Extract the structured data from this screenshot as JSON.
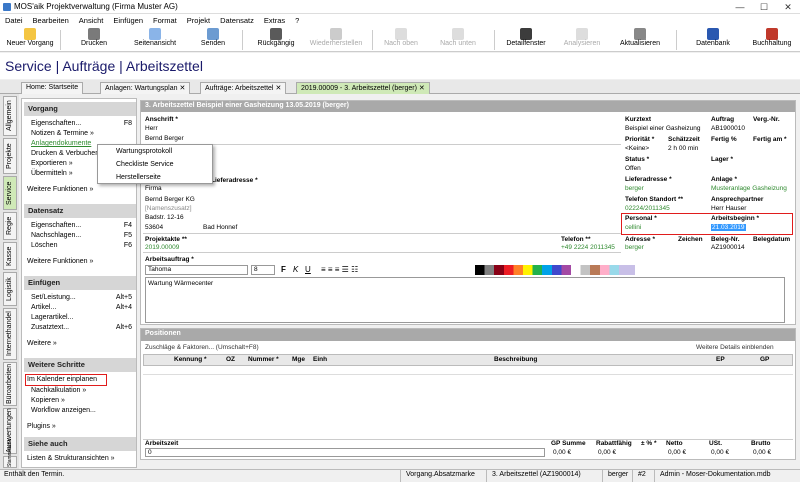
{
  "title": "MOS'aik Projektverwaltung (Firma Muster AG)",
  "menu": [
    "Datei",
    "Bearbeiten",
    "Ansicht",
    "Einfügen",
    "Format",
    "Projekt",
    "Datensatz",
    "Extras",
    "?"
  ],
  "toolbar": [
    "Neuer Vorgang",
    "Drucken",
    "Seitenansicht",
    "Senden",
    "Rückgängig",
    "Wiederherstellen",
    "Nach oben",
    "Nach unten",
    "Detailfenster",
    "Analysieren",
    "Aktualisieren",
    "Datenbank",
    "Buchhaltung"
  ],
  "page_title": "Service | Aufträge | Arbeitszettel",
  "tabs": [
    "Home: Startseite",
    "Anlagen: Wartungsplan",
    "Aufträge: Arbeitszettel",
    "2019.00009 - 3. Arbeitszettel (berger)"
  ],
  "vtabs": [
    "Allgemein",
    "Projekte",
    "Service",
    "Regie",
    "Kasse",
    "Logistik",
    "Internethandel",
    "Büroarbeiten",
    "Auswertungen",
    "Stammdaten"
  ],
  "sidebar": {
    "vorgang": {
      "title": "Vorgang",
      "items": [
        {
          "l": "Eigenschaften...",
          "k": "F8"
        },
        {
          "l": "Notizen & Termine »",
          "k": ""
        },
        {
          "l": "Anlagendokumente",
          "k": ""
        },
        {
          "l": "Drucken & Verbuchen",
          "k": ""
        },
        {
          "l": "Exportieren »",
          "k": ""
        },
        {
          "l": "Übermitteln »",
          "k": ""
        },
        {
          "l": "Weitere Funktionen »",
          "k": ""
        }
      ]
    },
    "datensatz": {
      "title": "Datensatz",
      "items": [
        {
          "l": "Eigenschaften...",
          "k": "F4"
        },
        {
          "l": "Nachschlagen...",
          "k": "F5"
        },
        {
          "l": "Löschen",
          "k": "F6"
        },
        {
          "l": "Weitere Funktionen »",
          "k": ""
        }
      ]
    },
    "einfuegen": {
      "title": "Einfügen",
      "items": [
        {
          "l": "Set/Leistung...",
          "k": "Alt+5"
        },
        {
          "l": "Artikel...",
          "k": "Alt+4"
        },
        {
          "l": "Lagerartikel...",
          "k": ""
        },
        {
          "l": "Zusatztext...",
          "k": "Alt+6"
        },
        {
          "l": "Weitere »",
          "k": ""
        }
      ]
    },
    "schritte": {
      "title": "Weitere Schritte",
      "items": [
        {
          "l": "Im Kalender einplanen",
          "k": ""
        },
        {
          "l": "Nachkalkulation »",
          "k": ""
        },
        {
          "l": "Kopieren »",
          "k": ""
        },
        {
          "l": "Workflow anzeigen...",
          "k": ""
        },
        {
          "l": "Plugins »",
          "k": ""
        }
      ]
    },
    "suche": {
      "title": "Siehe auch",
      "items": [
        {
          "l": "Listen & Strukturansichten »",
          "k": ""
        }
      ]
    }
  },
  "context_menu": [
    "Wartungsprotokoll",
    "Checkliste Service",
    "Herstellerseite"
  ],
  "main": {
    "header": "3. Arbeitszettel Beispiel einer Gasheizung 13.05.2019 (berger)",
    "anschrift_label": "Anschrift *",
    "anschrift": [
      "Herr",
      "Bernd Berger"
    ],
    "lieferanschrift_label": "Lieferadresse *",
    "rechnung_firma": "Firma",
    "rechnung": [
      "Bernd Berger KG",
      "[Namenszusatz]",
      "Badstr. 12-16"
    ],
    "plz": "53604",
    "ort": "Bad Honnef",
    "projektakte_label": "Projektakte **",
    "projektakte": "2019.00009",
    "telefon_label": "Telefon **",
    "telefon": "+49 2224 2011345",
    "kurztext_label": "Kurztext",
    "kurztext": "Beispiel einer Gasheizung",
    "auftrag_label": "Auftrag",
    "auftrag": "AB1900010",
    "verg_label": "Verg.-Nr.",
    "prioritaet_label": "Priorität *",
    "prioritaet": "<Keine>",
    "schaetzzeit_label": "Schätzzeit",
    "schaetzzeit": "2 h 00 min",
    "fertig_label": "Fertig %",
    "fertigam_label": "Fertig am *",
    "status_label": "Status *",
    "status": "Offen",
    "lager_label": "Lager *",
    "lieferadresse_label": "Lieferadresse *",
    "lieferadresse": "berger",
    "anlage_label": "Anlage *",
    "anlage": "Musteranlage Gasheizung",
    "telstandort_label": "Telefon Standort **",
    "telstandort": "02224/2011345",
    "ansprechpartner_label": "Ansprechpartner",
    "ansprechpartner": "Herr Hauser",
    "personal_label": "Personal *",
    "personal": "cellini",
    "arbeitsbeginn_label": "Arbeitsbeginn *",
    "arbeitsbeginn": "21.03.2019",
    "adresse_label": "Adresse *",
    "adresse": "berger",
    "zeichen_label": "Zeichen",
    "belegnr_label": "Beleg-Nr.",
    "belegnr": "AZ1900014",
    "belegdatum_label": "Belegdatum",
    "arbeitsauftrag_label": "Arbeitsauftrag *",
    "font": "Tahoma",
    "fontsize": "8",
    "arbeitsauftrag": "Wartung Wärmecenter"
  },
  "positionen": {
    "header": "Positionen",
    "hint": "Zuschläge & Faktoren... (Umschalt+F8)",
    "hint_right": "Weitere Details einblenden",
    "columns": [
      "Kennung *",
      "OZ",
      "Nummer *",
      "Mge",
      "Einh",
      "Beschreibung",
      "EP",
      "GP"
    ],
    "arbeitszeit_label": "Arbeitszeit",
    "arbeitszeit": "0",
    "sum_labels": [
      "GP Summe",
      "Rabattfähig",
      "± % *",
      "Netto",
      "USt.",
      "Brutto"
    ],
    "sums": [
      "0,00 €",
      "0,00 €",
      "",
      "0,00 €",
      "0,00 €",
      "0,00 €"
    ]
  },
  "status": [
    "Enthält den Termin.",
    "Vorgang.Absatzmarke",
    "3. Arbeitszettel (AZ1900014)",
    "berger",
    "#2",
    "Admin - Moser-Dokumentation.mdb"
  ],
  "colors": {
    "accent": "#cfe9b7",
    "green_text": "#2f8a2f",
    "highlight": "#e01c1c",
    "selection": "#3399ff"
  }
}
